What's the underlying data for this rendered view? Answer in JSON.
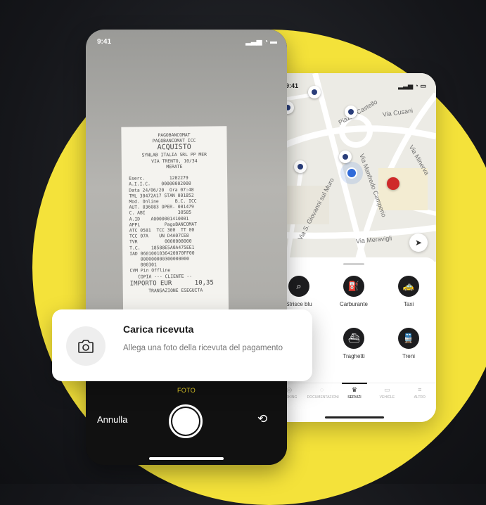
{
  "colors": {
    "brand_yellow": "#f4e23a",
    "accent_foto": "#e8d22a",
    "dark_bg": "#15161a"
  },
  "map_phone": {
    "time": "9:41",
    "streets": [
      "Piazza Castello",
      "Via Cusani",
      "Via Minerva",
      "Via Manfredo Camperio",
      "Via S. Giovanni sul Muro",
      "Via Meravigli"
    ],
    "services": [
      {
        "label": "Strisce blu",
        "icon": "parking-search-icon"
      },
      {
        "label": "Carburante",
        "icon": "fuel-icon"
      },
      {
        "label": "Taxi",
        "icon": "taxi-icon"
      },
      {
        "label": "Traghetti",
        "icon": "ferry-icon"
      },
      {
        "label": "Treni",
        "icon": "train-icon"
      }
    ],
    "tabs": [
      "PARKING",
      "DOCUMENTAZIONI",
      "SERVIZI",
      "VEHICLE",
      "ALTRO"
    ]
  },
  "camera_phone": {
    "time": "9:41",
    "receipt": {
      "header1": "PAGOBANCOMAT",
      "header2": "PAGOBANCOMAT ICC",
      "title": "ACQUISTO",
      "merchant1": "SYNLAB ITALIA SRL PP MER",
      "merchant2": "VIA TRENTO, 10/34",
      "city": "MERATE",
      "body": "Eserc.         1282279\nA.I.I.C.    00000002008\nData 24/06/20  Ora 07:48\nTML 30472A17 STAN 001852\nMod. Online      B.C. ICC\nAUT. 036083 OPER. 001479\nC. ABI            30585\nA.ID    A0000001410001\nAPPL         PagoBANCOMAT\nATC 0581  TCC 300  TT 00\nTCC 07A    UN D4A07CE8\nTVR          0000008000\nT.C.    18588E5A0A475EE1\nIAD 0601001036420070FF00\n    000000000300000000\n    000301\nCVM Pin Offline\n   COPIA --- CLIENTE --",
      "total_label": "IMPORTO EUR",
      "total_value": "10,35",
      "footer": "TRANSAZIONE ESEGUITA"
    },
    "mode_label": "FOTO",
    "cancel_label": "Annulla"
  },
  "upload_card": {
    "title": "Carica ricevuta",
    "subtitle": "Allega una foto della ricevuta del pagamento"
  }
}
